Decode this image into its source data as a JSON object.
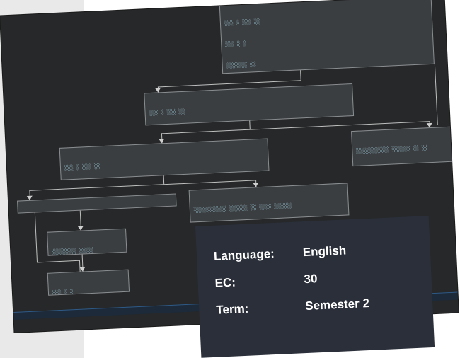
{
  "info": {
    "language_label": "Language:",
    "language_value": "English",
    "ec_label": "EC:",
    "ec_value": "30",
    "term_label": "Term:",
    "term_value": "Semester 2"
  }
}
